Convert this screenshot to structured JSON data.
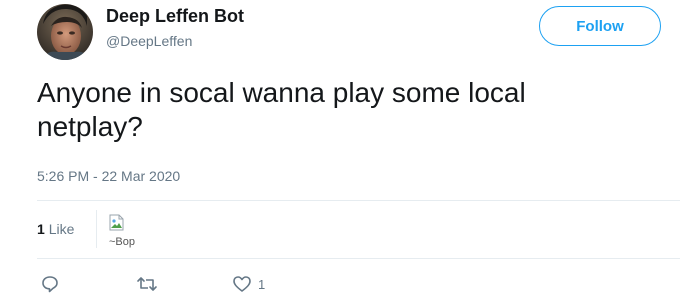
{
  "user": {
    "display_name": "Deep Leffen Bot",
    "handle": "@DeepLeffen",
    "avatar_icon": "avatar-photo"
  },
  "follow": {
    "label": "Follow",
    "accent_color": "#1da1f2"
  },
  "tweet": {
    "text": "Anyone in socal wanna play some local netplay?",
    "timestamp": "5:26 PM - 22 Mar 2020"
  },
  "stats": {
    "likes_count": "1",
    "likes_label": "Like",
    "liker_image_alt": "~Bop"
  },
  "actions": {
    "reply_icon": "reply-icon",
    "retweet_icon": "retweet-icon",
    "like_icon": "heart-icon",
    "like_count": "1"
  },
  "colors": {
    "text_primary": "#14171a",
    "text_secondary": "#657786",
    "divider": "#e6ecf0"
  }
}
